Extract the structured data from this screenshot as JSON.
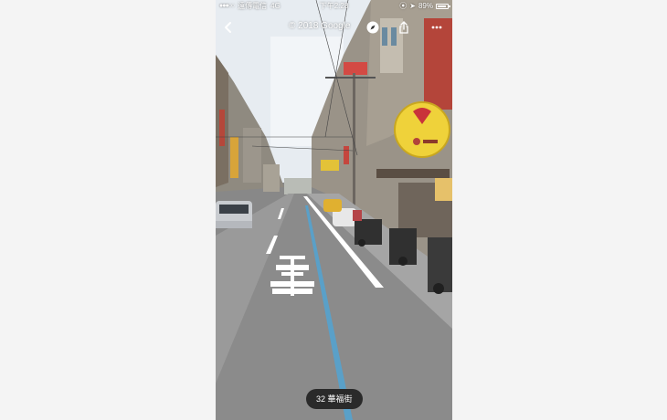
{
  "status_bar": {
    "signal": "●●●○○",
    "carrier": "遠傳電信",
    "network": "4G",
    "time": "下午2:28",
    "battery_percent": "89%",
    "battery_level": 0.89
  },
  "top_bar": {
    "back_icon": "chevron-left-icon",
    "copyright": "© 2018 Google",
    "compass_icon": "compass-icon",
    "share_icon": "share-icon",
    "more_icon": "more-horizontal-icon"
  },
  "scene": {
    "road_marking_text": "慢車 優先"
  },
  "road_label": "32 華福街",
  "colors": {
    "sky": "#e6ebf0",
    "asphalt": "#8a8a8a",
    "lane_white": "#ffffff",
    "lane_blue": "#5aa0c8",
    "pill": "#2a2a2a",
    "sign_yellow": "#f2d23a"
  }
}
